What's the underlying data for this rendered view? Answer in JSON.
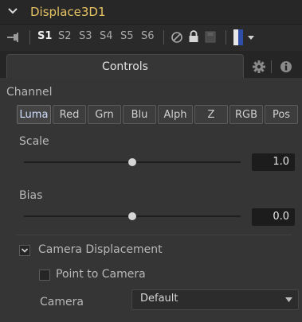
{
  "header": {
    "title": "Displace3D1",
    "title_color": "#e6c262"
  },
  "versions": {
    "items": [
      "S1",
      "S2",
      "S3",
      "S4",
      "S5",
      "S6"
    ],
    "active": "S1"
  },
  "tabs": {
    "controls_label": "Controls",
    "settings_icon": "gear-icon",
    "info_icon": "info-icon"
  },
  "channel": {
    "label": "Channel",
    "buttons": [
      "Luma",
      "Red",
      "Grn",
      "Blu",
      "Alph",
      "Z",
      "RGB",
      "Pos"
    ],
    "selected": "Luma"
  },
  "scale": {
    "label": "Scale",
    "value": "1.0",
    "slider_fraction": 0.5
  },
  "bias": {
    "label": "Bias",
    "value": "0.0",
    "slider_fraction": 0.5
  },
  "camera_displacement": {
    "label": "Camera Displacement",
    "expanded": true
  },
  "point_to_camera": {
    "label": "Point to Camera",
    "checked": false
  },
  "camera": {
    "label": "Camera",
    "value": "Default"
  }
}
